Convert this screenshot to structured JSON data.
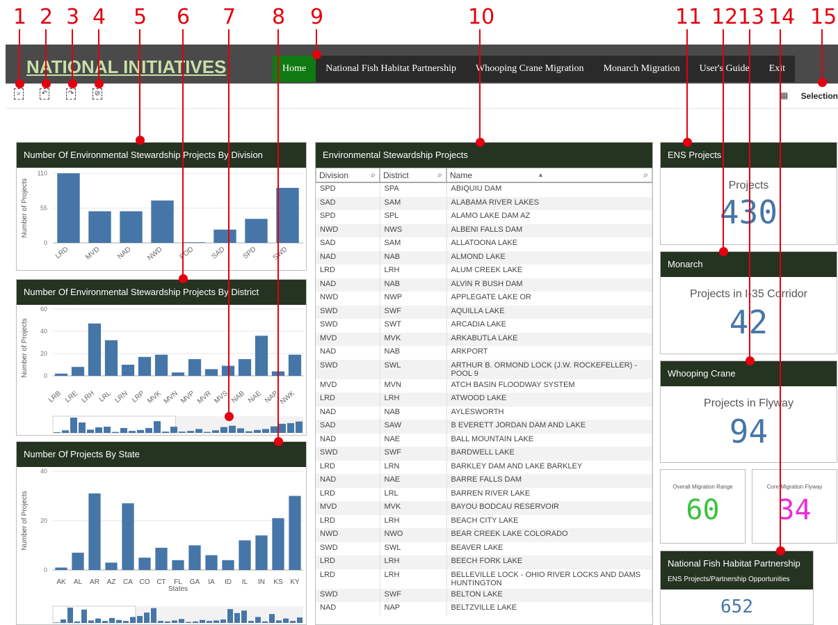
{
  "callouts": [
    "1",
    "2",
    "3",
    "4",
    "5",
    "6",
    "7",
    "8",
    "9",
    "10",
    "11",
    "12",
    "13",
    "14",
    "15"
  ],
  "header": {
    "title": "NATIONAL INITIATIVES",
    "nav": [
      "Home",
      "National Fish Habitat Partnership",
      "Whooping Crane Migration",
      "Monarch Migration",
      "User's Guide",
      "Exit"
    ],
    "active_nav": "Home",
    "selections_label": "Selection"
  },
  "toolbar_icons": [
    "smart-search-icon",
    "step-back-icon",
    "step-forward-icon",
    "clear-selections-icon"
  ],
  "colors": {
    "bar": "#4676a8",
    "title_bar": "#253321",
    "nav_active": "#0f7a12",
    "callout": "#e3000f",
    "green_value": "#39c43b",
    "magenta_value": "#ee2bd7"
  },
  "chart_division": {
    "title": "Number Of Environmental Stewardship Projects By Division",
    "ylabel": "Number of Projects",
    "yticks": [
      "110",
      "55",
      "0"
    ],
    "chart_data": {
      "type": "bar",
      "categories": [
        "LRD",
        "MVD",
        "NAD",
        "NWD",
        "POD",
        "SAD",
        "SPD",
        "SWD"
      ],
      "values": [
        110,
        50,
        50,
        67,
        1,
        21,
        38,
        87
      ],
      "ylim": [
        0,
        110
      ]
    }
  },
  "chart_district": {
    "title": "Number Of Environmental Stewardship Projects By District",
    "ylabel": "Number of Projects",
    "yticks": [
      "60",
      "40",
      "20",
      "0"
    ],
    "chart_data": {
      "type": "bar",
      "categories": [
        "LRB",
        "LRE",
        "LRH",
        "LRL",
        "LRN",
        "LRP",
        "MVK",
        "MVN",
        "MVP",
        "MVR",
        "MVS",
        "NAB",
        "NAE",
        "NAP",
        "NWK"
      ],
      "values": [
        2,
        8,
        47,
        32,
        10,
        17,
        19,
        3,
        15,
        6,
        9,
        15,
        36,
        4,
        19
      ],
      "ylim": [
        -10,
        60
      ]
    }
  },
  "chart_state": {
    "title": "Number Of Projects By State",
    "ylabel": "Number of Projects",
    "xlabel": "States",
    "yticks": [
      "40",
      "20",
      "0"
    ],
    "chart_data": {
      "type": "bar",
      "categories": [
        "AK",
        "AL",
        "AR",
        "AZ",
        "CA",
        "CO",
        "CT",
        "FL",
        "GA",
        "IA",
        "ID",
        "IL",
        "IN",
        "KS",
        "KY"
      ],
      "values": [
        1,
        7,
        31,
        3,
        27,
        5,
        9,
        4,
        10,
        6,
        4,
        12,
        14,
        21,
        30
      ],
      "ylim": [
        0,
        40
      ]
    }
  },
  "table": {
    "title": "Environmental Stewardship Projects",
    "headers": [
      "Division",
      "District",
      "Name"
    ],
    "rows": [
      [
        "SPD",
        "SPA",
        "ABIQUIU DAM"
      ],
      [
        "SAD",
        "SAM",
        "ALABAMA RIVER LAKES"
      ],
      [
        "SPD",
        "SPL",
        "ALAMO LAKE DAM AZ"
      ],
      [
        "NWD",
        "NWS",
        "ALBENI FALLS DAM"
      ],
      [
        "SAD",
        "SAM",
        "ALLATOONA LAKE"
      ],
      [
        "NAD",
        "NAB",
        "ALMOND LAKE"
      ],
      [
        "LRD",
        "LRH",
        "ALUM CREEK LAKE"
      ],
      [
        "NAD",
        "NAB",
        "ALVIN R BUSH DAM"
      ],
      [
        "NWD",
        "NWP",
        "APPLEGATE LAKE OR"
      ],
      [
        "SWD",
        "SWF",
        "AQUILLA LAKE"
      ],
      [
        "SWD",
        "SWT",
        "ARCADIA LAKE"
      ],
      [
        "MVD",
        "MVK",
        "ARKABUTLA LAKE"
      ],
      [
        "NAD",
        "NAB",
        "ARKPORT"
      ],
      [
        "SWD",
        "SWL",
        "ARTHUR B. ORMOND LOCK (J.W. ROCKEFELLER) - POOL 9"
      ],
      [
        "MVD",
        "MVN",
        "ATCH BASIN FLOODWAY SYSTEM"
      ],
      [
        "LRD",
        "LRH",
        "ATWOOD LAKE"
      ],
      [
        "NAD",
        "NAB",
        "AYLESWORTH"
      ],
      [
        "SAD",
        "SAW",
        "B EVERETT JORDAN DAM AND LAKE"
      ],
      [
        "NAD",
        "NAE",
        "BALL MOUNTAIN LAKE"
      ],
      [
        "SWD",
        "SWF",
        "BARDWELL LAKE"
      ],
      [
        "LRD",
        "LRN",
        "BARKLEY DAM AND LAKE BARKLEY"
      ],
      [
        "NAD",
        "NAE",
        "BARRE FALLS DAM"
      ],
      [
        "LRD",
        "LRL",
        "BARREN RIVER LAKE"
      ],
      [
        "MVD",
        "MVK",
        "BAYOU BODCAU RESERVOIR"
      ],
      [
        "LRD",
        "LRH",
        "BEACH CITY LAKE"
      ],
      [
        "NWD",
        "NWO",
        "BEAR CREEK LAKE COLORADO"
      ],
      [
        "SWD",
        "SWL",
        "BEAVER LAKE"
      ],
      [
        "LRD",
        "LRH",
        "BEECH FORK LAKE"
      ],
      [
        "LRD",
        "LRH",
        "BELLEVILLE LOCK - OHIO RIVER LOCKS AND DAMS HUNTINGTON"
      ],
      [
        "SWD",
        "SWF",
        "BELTON LAKE"
      ],
      [
        "NAD",
        "NAP",
        "BELTZVILLE LAKE"
      ]
    ]
  },
  "kpi_ens": {
    "title": "ENS Projects",
    "label": "Projects",
    "value": "430"
  },
  "kpi_monarch": {
    "title": "Monarch",
    "label": "Projects in I-35 Corridor",
    "value": "42"
  },
  "kpi_crane": {
    "title": "Whooping Crane",
    "label": "Projects in Flyway",
    "value": "94"
  },
  "kpi_range": {
    "label": "Overall Migration Range",
    "value": "60"
  },
  "kpi_core": {
    "label": "Core Migration Flyway",
    "value": "34"
  },
  "kpi_fish": {
    "title": "National Fish Habitat Partnership",
    "subtitle": "ENS Projects/Partnership Opportunities",
    "value": "652"
  }
}
